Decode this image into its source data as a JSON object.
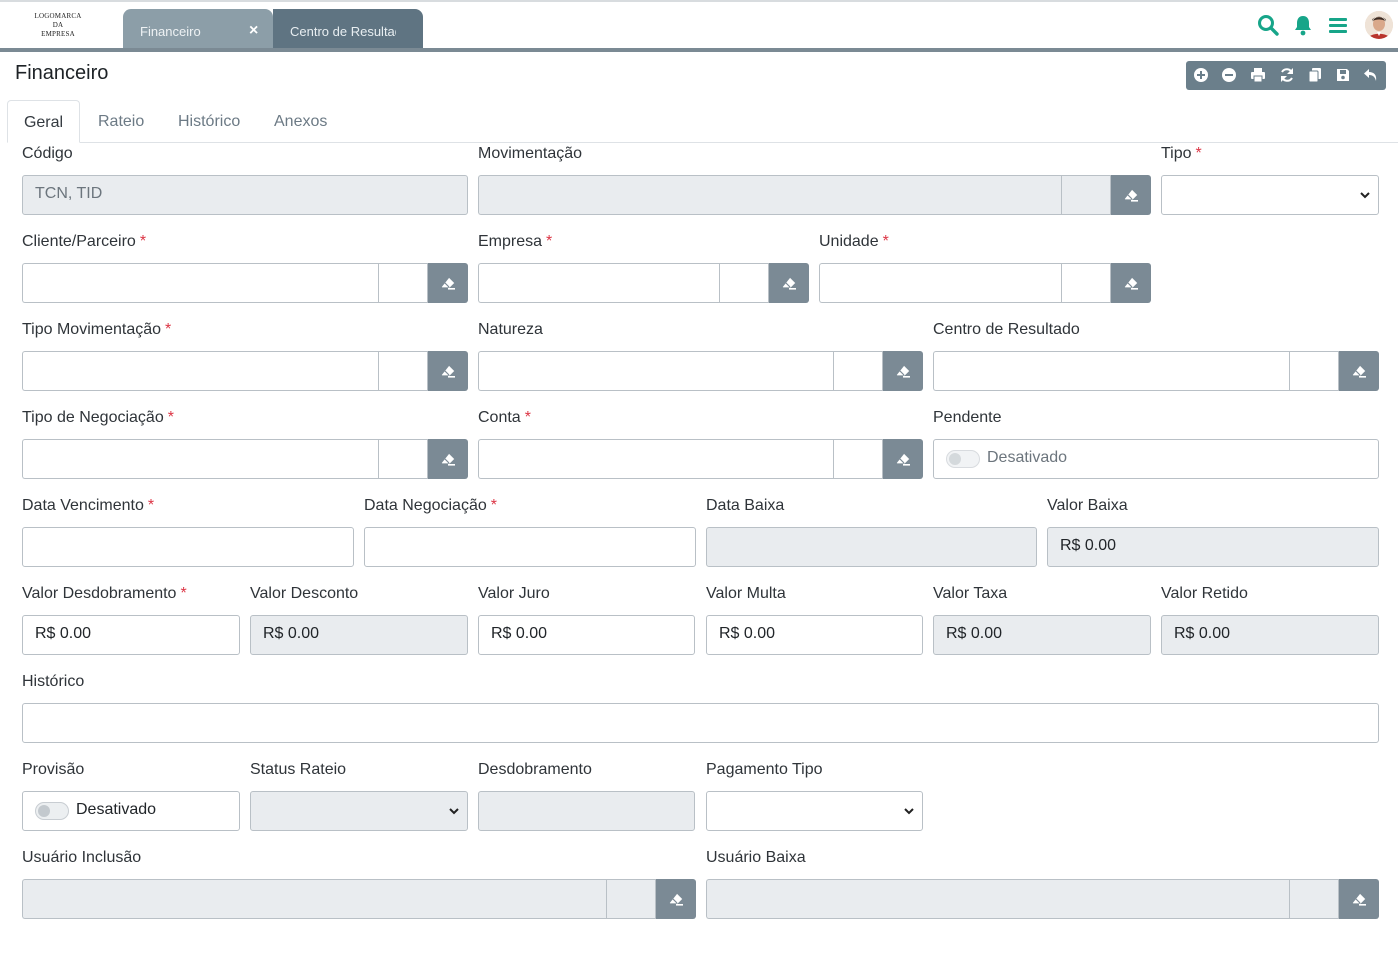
{
  "app": {
    "logo_lines": [
      "LOGOMARCA",
      "DA",
      "EMPRESA"
    ],
    "open_tabs": [
      {
        "label": "Financeiro"
      },
      {
        "label": "Centro de Resultado"
      }
    ],
    "close_glyph": "×",
    "top_icons": [
      "search-icon",
      "bell-icon",
      "menu-icon"
    ],
    "accent": "#17a589"
  },
  "page": {
    "title": "Financeiro",
    "toolbar_icons": [
      "add-icon",
      "remove-icon",
      "print-icon",
      "refresh-icon",
      "copy-icon",
      "save-icon",
      "undo-icon"
    ]
  },
  "tabs": [
    {
      "label": "Geral",
      "active": true
    },
    {
      "label": "Rateio"
    },
    {
      "label": "Histórico"
    },
    {
      "label": "Anexos"
    }
  ],
  "required_mark": "*",
  "form": {
    "codigo": {
      "label": "Código",
      "placeholder": "TCN, TID"
    },
    "movimentacao": {
      "label": "Movimentação"
    },
    "tipo": {
      "label": "Tipo"
    },
    "cliente": {
      "label": "Cliente/Parceiro"
    },
    "empresa": {
      "label": "Empresa"
    },
    "unidade": {
      "label": "Unidade"
    },
    "tipo_movimentacao": {
      "label": "Tipo Movimentação"
    },
    "natureza": {
      "label": "Natureza"
    },
    "centro_resultado": {
      "label": "Centro de Resultado"
    },
    "tipo_negociacao": {
      "label": "Tipo de Negociação"
    },
    "conta": {
      "label": "Conta"
    },
    "pendente": {
      "label": "Pendente",
      "state": "Desativado"
    },
    "data_vencimento": {
      "label": "Data Vencimento"
    },
    "data_negociacao": {
      "label": "Data Negociação"
    },
    "data_baixa": {
      "label": "Data Baixa"
    },
    "valor_baixa": {
      "label": "Valor Baixa",
      "value": "R$ 0.00"
    },
    "valor_desdobramento": {
      "label": "Valor Desdobramento",
      "value": "R$ 0.00"
    },
    "valor_desconto": {
      "label": "Valor Desconto",
      "value": "R$ 0.00"
    },
    "valor_juro": {
      "label": "Valor Juro",
      "value": "R$ 0.00"
    },
    "valor_multa": {
      "label": "Valor Multa",
      "value": "R$ 0.00"
    },
    "valor_taxa": {
      "label": "Valor Taxa",
      "value": "R$ 0.00"
    },
    "valor_retido": {
      "label": "Valor Retido",
      "value": "R$ 0.00"
    },
    "historico": {
      "label": "Histórico"
    },
    "provisao": {
      "label": "Provisão",
      "state": "Desativado"
    },
    "status_rateio": {
      "label": "Status Rateio"
    },
    "desdobramento": {
      "label": "Desdobramento"
    },
    "pagamento_tipo": {
      "label": "Pagamento Tipo"
    },
    "usuario_inclusao": {
      "label": "Usuário Inclusão"
    },
    "usuario_baixa": {
      "label": "Usuário Baixa"
    }
  }
}
